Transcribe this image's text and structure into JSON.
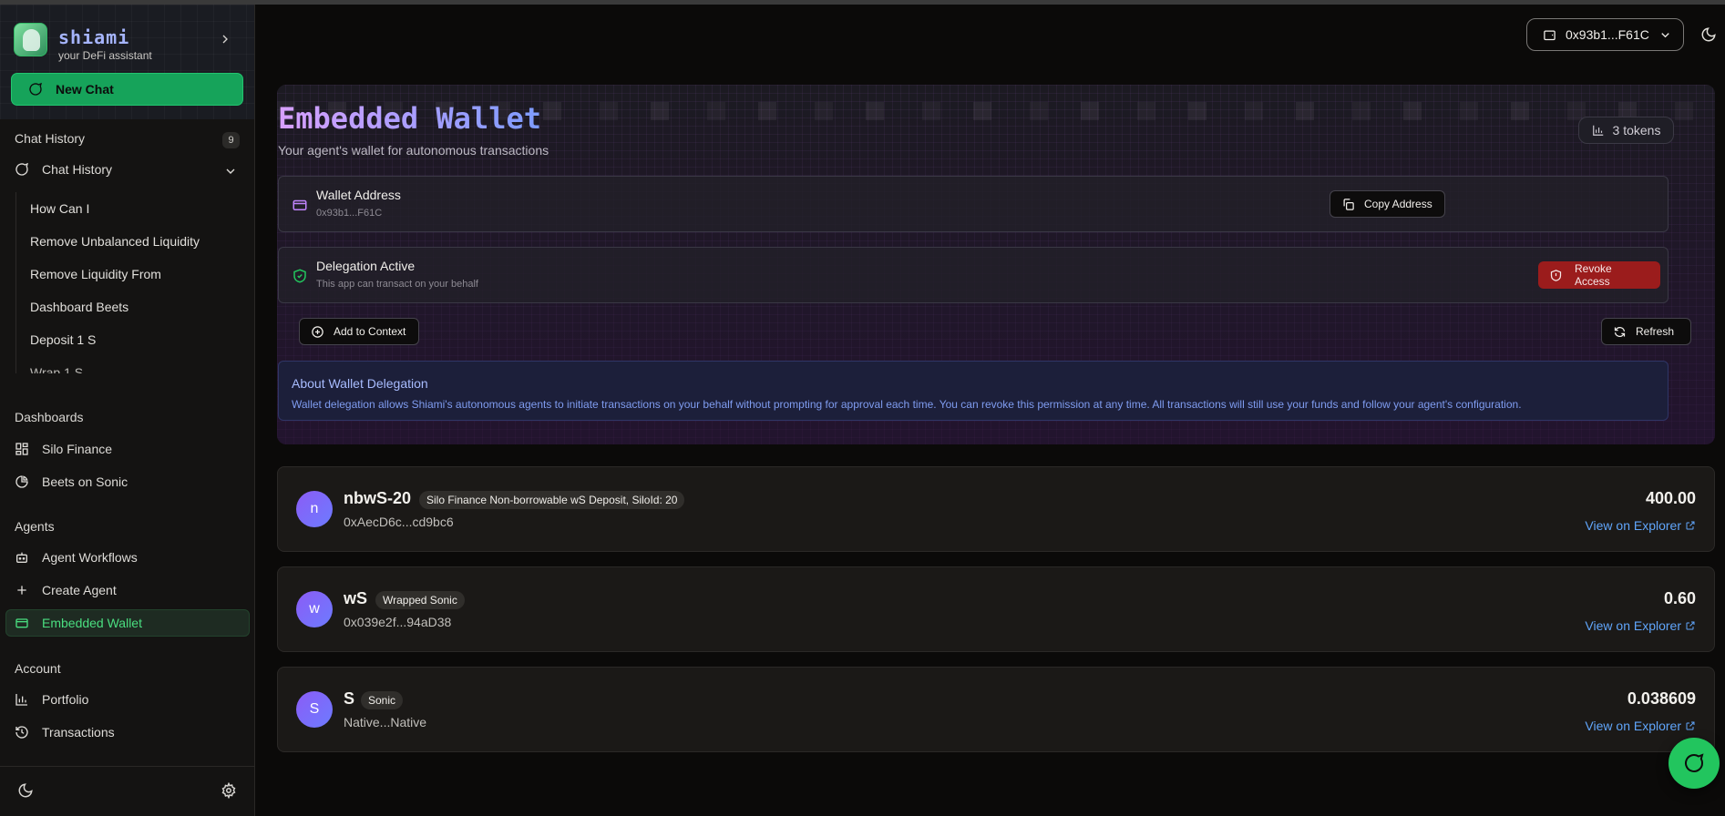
{
  "app": {
    "name": "shiami",
    "tagline": "your DeFi assistant",
    "new_chat_label": "New Chat"
  },
  "sidebar": {
    "chat_history_title": "Chat History",
    "chat_history_count": "9",
    "chat_history_group": "Chat History",
    "history_items": [
      "How Can I",
      "Remove Unbalanced Liquidity",
      "Remove Liquidity From",
      "Dashboard Beets",
      "Deposit 1 S",
      "Wrap 1 S"
    ],
    "dashboards_title": "Dashboards",
    "dashboards": [
      {
        "label": "Silo Finance",
        "icon": "grid-icon"
      },
      {
        "label": "Beets on Sonic",
        "icon": "pie-chart-icon"
      }
    ],
    "agents_title": "Agents",
    "agents": [
      {
        "label": "Agent Workflows",
        "icon": "bot-icon"
      },
      {
        "label": "Create Agent",
        "icon": "plus-icon"
      },
      {
        "label": "Embedded Wallet",
        "icon": "wallet-icon",
        "active": true
      }
    ],
    "account_title": "Account",
    "account": [
      {
        "label": "Portfolio",
        "icon": "bar-chart-icon"
      },
      {
        "label": "Transactions",
        "icon": "history-icon"
      }
    ]
  },
  "header": {
    "wallet_address": "0x93b1...F61C"
  },
  "wallet_panel": {
    "title": "Embedded Wallet",
    "subtitle": "Your agent's wallet for autonomous transactions",
    "tokens_count": "3 tokens",
    "address_label": "Wallet Address",
    "address_value": "0x93b1...F61C",
    "copy_label": "Copy Address",
    "delegation_label": "Delegation Active",
    "delegation_desc": "This app can transact on your behalf",
    "revoke_label": "Revoke Access",
    "add_context_label": "Add to Context",
    "refresh_label": "Refresh",
    "about_title": "About Wallet Delegation",
    "about_text": "Wallet delegation allows Shiami's autonomous agents to initiate transactions on your behalf without prompting for approval each time. You can revoke this permission at any time. All transactions will still use your funds and follow your agent's configuration."
  },
  "tokens": [
    {
      "initial": "n",
      "symbol": "nbwS-20",
      "name": "Silo Finance Non-borrowable wS Deposit, SiloId: 20",
      "address": "0xAecD6c...cd9bc6",
      "amount": "400.00",
      "link": "View on Explorer"
    },
    {
      "initial": "w",
      "symbol": "wS",
      "name": "Wrapped Sonic",
      "address": "0x039e2f...94aD38",
      "amount": "0.60",
      "link": "View on Explorer"
    },
    {
      "initial": "S",
      "symbol": "S",
      "name": "Sonic",
      "address": "Native...Native",
      "amount": "0.038609",
      "link": "View on Explorer"
    }
  ],
  "colors": {
    "accent_green": "#22c55e",
    "danger_red": "#9b1c1c",
    "link_blue": "#60a5fa",
    "title_gradient_start": "#d8a0ff",
    "title_gradient_end": "#7d9cff"
  }
}
